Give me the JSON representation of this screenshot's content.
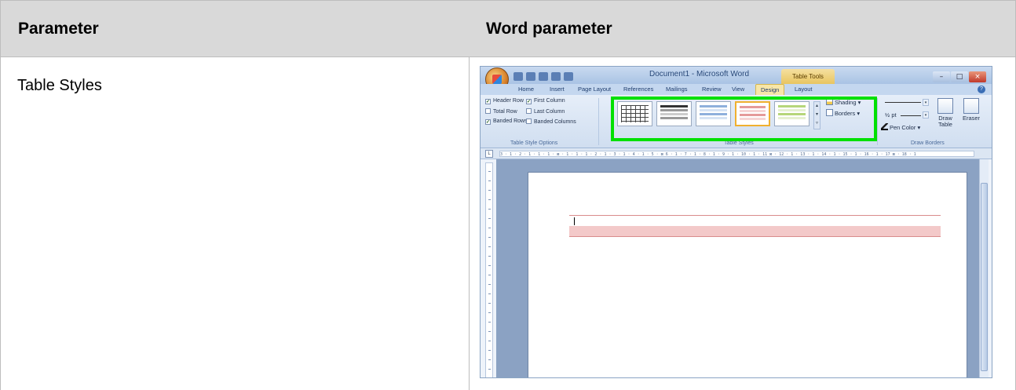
{
  "table": {
    "headers": [
      "Parameter",
      "Word parameter"
    ],
    "rows": [
      {
        "parameter": "Table Styles"
      }
    ]
  },
  "word_screenshot": {
    "title": "Document1 - Microsoft Word",
    "contextual_tab": "Table Tools",
    "tabs": [
      "Home",
      "Insert",
      "Page Layout",
      "References",
      "Mailings",
      "Review",
      "View",
      "Design",
      "Layout"
    ],
    "active_tab": "Design",
    "style_options": {
      "items": [
        {
          "label": "Header Row",
          "checked": true
        },
        {
          "label": "First Column",
          "checked": true
        },
        {
          "label": "Total Row",
          "checked": false
        },
        {
          "label": "Last Column",
          "checked": false
        },
        {
          "label": "Banded Rows",
          "checked": true
        },
        {
          "label": "Banded Columns",
          "checked": false
        }
      ],
      "group_label": "Table Style Options"
    },
    "styles": {
      "group_label": "Table Styles",
      "shading_label": "Shading",
      "borders_label": "Borders",
      "highlight_color": "#00e000"
    },
    "draw_borders": {
      "group_label": "Draw Borders",
      "pt_label": "½ pt",
      "pen_color_label": "Pen Color",
      "draw_table_label_1": "Draw",
      "draw_table_label_2": "Table",
      "eraser_label": "Eraser"
    },
    "ruler_text": "3 · 1 · 2 · 1 · 1 · 1 · ⊠ · 1 · 1 · 1 · 2 · 1 · 3 · 1 · 4 · 1 · 5 · ⊠ 6 · 1 · 7 · 1 · 8 · 1 · 9 · 1 · 10 · 1 · 11 ⊠ · 12 · 1 · 13 · 1 · 14 · 1 · 15 · 1 · 16 · 1 · 17 ⊠ · 18 · 1"
  }
}
